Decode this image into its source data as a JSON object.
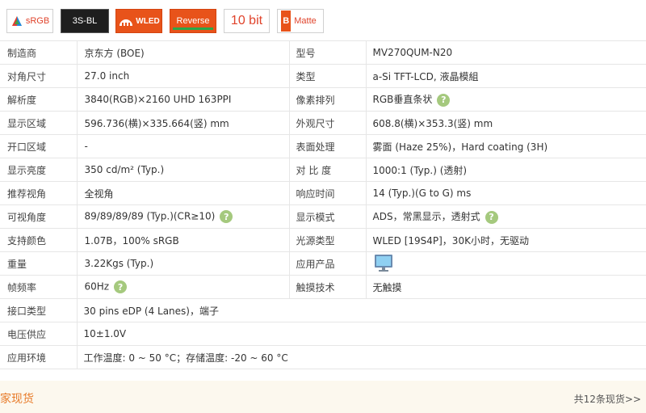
{
  "badges": {
    "srgb": "sRGB",
    "backlight": "3S-BL",
    "wled": "WLED",
    "reverse": "Reverse",
    "bit": "10 bit",
    "matte_letter": "B",
    "matte": "Matte"
  },
  "colors": {
    "accent": "#e8531a",
    "help": "#a5c97e",
    "footer_bg": "#fcf8ee",
    "footer_link": "#e77a28"
  },
  "specs": [
    {
      "l1": "制造商",
      "v1": "京东方 (BOE)",
      "l2": "型号",
      "v2": "MV270QUM-N20"
    },
    {
      "l1": "对角尺寸",
      "v1": "27.0 inch",
      "l2": "类型",
      "v2": "a-Si TFT-LCD, 液晶模組"
    },
    {
      "l1": "解析度",
      "v1": "3840(RGB)×2160   UHD   163PPI",
      "l2": "像素排列",
      "v2": "RGB垂直条状",
      "h2": true
    },
    {
      "l1": "显示区域",
      "v1": "596.736(横)×335.664(竖) mm",
      "l2": "外观尺寸",
      "v2": "608.8(横)×353.3(竖) mm"
    },
    {
      "l1": "开口区域",
      "v1": "-",
      "l2": "表面处理",
      "v2": "雾面 (Haze 25%)，Hard coating (3H)"
    },
    {
      "l1": "显示亮度",
      "v1": "350 cd/m² (Typ.)",
      "l2": "对 比 度",
      "v2": "1000:1 (Typ.) (透射)"
    },
    {
      "l1": "推荐视角",
      "v1": "全视角",
      "l2": "响应时间",
      "v2": "14 (Typ.)(G to G) ms"
    },
    {
      "l1": "可视角度",
      "v1": "89/89/89/89 (Typ.)(CR≥10)",
      "h1": true,
      "l2": "显示模式",
      "v2": "ADS，常黑显示，透射式",
      "h2": true
    },
    {
      "l1": "支持颜色",
      "v1": "1.07B，100% sRGB",
      "l2": "光源类型",
      "v2": "WLED  [19S4P]，30K小时，无驱动"
    },
    {
      "l1": "重量",
      "v1": "3.22Kgs (Typ.)",
      "l2": "应用产品",
      "v2": "",
      "icon2": "monitor-icon"
    },
    {
      "l1": "帧频率",
      "v1": "60Hz",
      "h1": true,
      "l2": "触摸技术",
      "v2": "无触摸"
    },
    {
      "l1": "接口类型",
      "v1": "30 pins   eDP (4 Lanes)，端子"
    },
    {
      "l1": "电压供应",
      "v1": "10±1.0V"
    },
    {
      "l1": "应用环境",
      "v1": "工作温度: 0 ~ 50 °C；存储温度: -20 ~ 60 °C"
    }
  ],
  "help_glyph": "?",
  "footer": {
    "left": "家现货",
    "right": "共12条现货>>"
  }
}
